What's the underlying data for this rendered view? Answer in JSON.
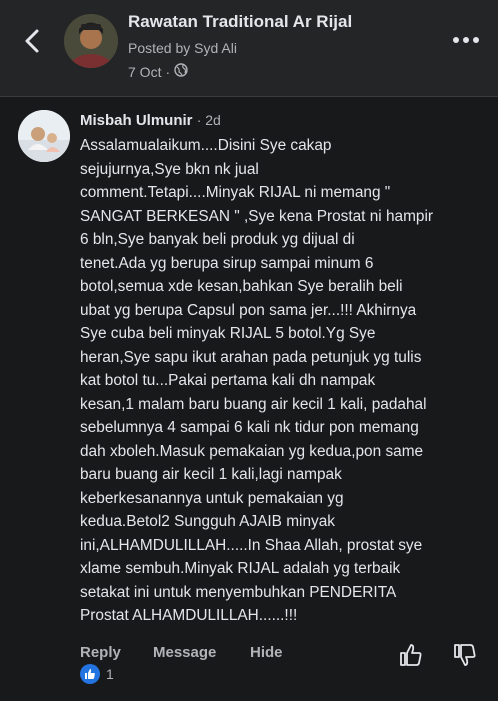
{
  "header": {
    "page_title": "Rawatan Traditional Ar Rijal",
    "posted_by": "Posted by Syd Ali",
    "date": "7 Oct",
    "date_separator": "·"
  },
  "comment": {
    "author": "Misbah Ulmunir",
    "time": "· 2d",
    "text": "Assalamualaikum....Disini Sye cakap\nsejujurnya,Sye bkn nk jual\ncomment.Tetapi....Minyak RIJAL ni memang \"\nSANGAT BERKESAN \" ,Sye kena Prostat ni hampir\n6 bln,Sye banyak beli produk yg dijual di\ntenet.Ada yg berupa sirup sampai minum 6\nbotol,semua xde kesan,bahkan Sye beralih beli\nubat yg berupa Capsul pon sama jer...!!! Akhirnya\nSye cuba beli minyak RIJAL 5 botol.Yg Sye\nheran,Sye sapu ikut arahan pada petunjuk yg tulis\nkat botol tu...Pakai pertama kali dh nampak\nkesan,1 malam baru buang air kecil 1 kali, padahal\nsebelumnya 4 sampai 6 kali nk tidur pon memang\ndah xboleh.Masuk pemakaian yg kedua,pon same\nbaru buang air kecil 1 kali,lagi nampak\nkeberkesanannya untuk pemakaian yg\nkedua.Betol2 Sungguh AJAIB minyak\nini,ALHAMDULILLAH.....In Shaa Allah, prostat sye\nxlame sembuh.Minyak RIJAL adalah yg terbaik\nsetakat ini untuk menyembuhkan PENDERITA\nProstat ALHAMDULILLAH......!!!",
    "actions": {
      "reply": "Reply",
      "message": "Message",
      "hide": "Hide"
    },
    "reaction_count": "1"
  },
  "colors": {
    "background": "#18191a",
    "header_bg": "#242526",
    "text": "#e4e6eb",
    "muted": "#b0b3b8",
    "like_blue": "#2374e1"
  },
  "icons": [
    "back-arrow-icon",
    "globe-icon",
    "more-options-icon",
    "like-icon",
    "dislike-icon",
    "like-reaction-icon"
  ]
}
